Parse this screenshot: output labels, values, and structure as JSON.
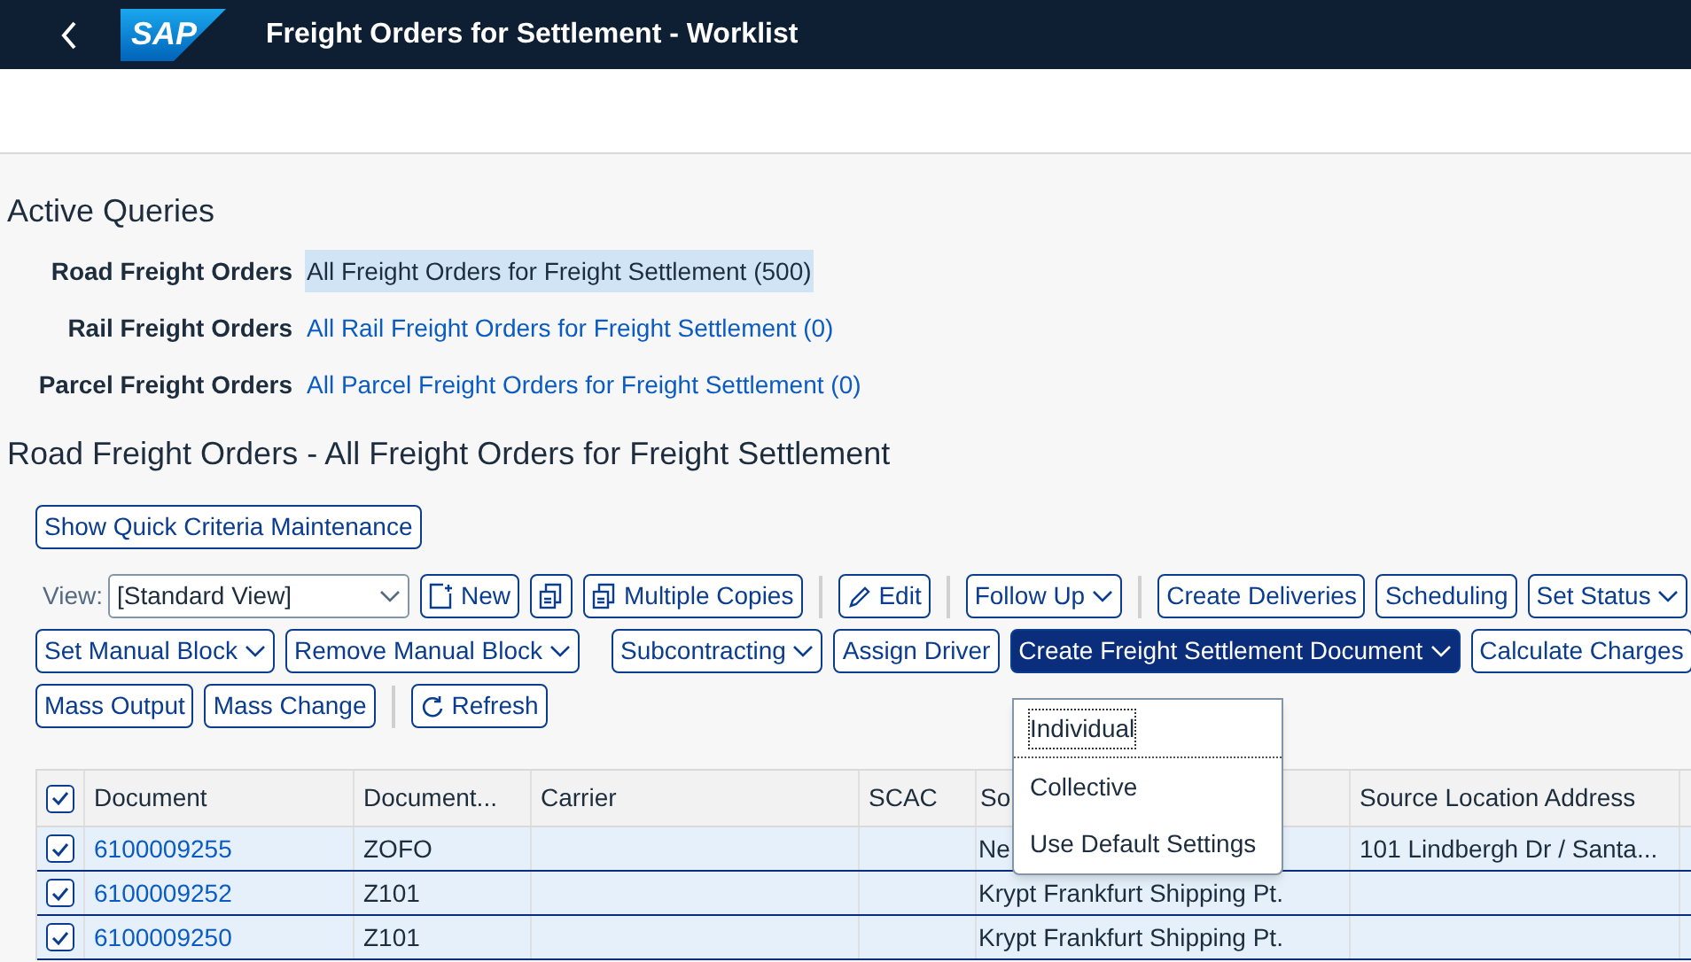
{
  "shell": {
    "logo": "SAP",
    "title": "Freight Orders for Settlement - Worklist"
  },
  "active_queries": {
    "title": "Active Queries",
    "queries": [
      {
        "label": "Road Freight Orders",
        "link": "All Freight Orders for Freight Settlement (500)",
        "selected": true
      },
      {
        "label": "Rail Freight Orders",
        "link": "All Rail Freight Orders for Freight Settlement (0)",
        "selected": false
      },
      {
        "label": "Parcel Freight Orders",
        "link": "All Parcel Freight Orders for Freight Settlement (0)",
        "selected": false
      }
    ]
  },
  "section_title": "Road Freight Orders - All Freight Orders for Freight Settlement",
  "quick_criteria_button": "Show Quick Criteria Maintenance",
  "toolbar_rows": [
    [
      {
        "kind": "view",
        "label": "View:",
        "value": "[Standard View]"
      },
      {
        "kind": "new",
        "label": "New"
      },
      {
        "kind": "copy"
      },
      {
        "kind": "copy",
        "label": "Multiple Copies"
      },
      {
        "kind": "separator"
      },
      {
        "kind": "edit",
        "label": "Edit"
      },
      {
        "kind": "separator"
      },
      {
        "kind": "menu",
        "label": "Follow Up",
        "expanded": false
      },
      {
        "kind": "separator"
      },
      {
        "kind": "button",
        "label": "Create Deliveries"
      },
      {
        "kind": "button",
        "label": "Scheduling"
      },
      {
        "kind": "menu",
        "label": "Set Status",
        "expanded": false
      }
    ],
    [
      {
        "kind": "menu",
        "label": "Set Manual Block",
        "expanded": false
      },
      {
        "kind": "menu",
        "label": "Remove Manual Block",
        "expanded": false
      },
      {
        "kind": "separator"
      },
      {
        "kind": "menu",
        "label": "Subcontracting",
        "expanded": false
      },
      {
        "kind": "button",
        "label": "Assign Driver"
      },
      {
        "kind": "menu",
        "label": "Create Freight Settlement Document",
        "expanded": true
      },
      {
        "kind": "button",
        "label": "Calculate Charges"
      }
    ],
    [
      {
        "kind": "button",
        "label": "Mass Output"
      },
      {
        "kind": "button",
        "label": "Mass Change"
      },
      {
        "kind": "separator"
      },
      {
        "kind": "refresh",
        "label": "Refresh"
      }
    ]
  ],
  "menu": {
    "items": [
      {
        "label": "Individual",
        "focused": true
      },
      {
        "label": "Collective",
        "focused": false
      },
      {
        "label": "Use Default Settings",
        "focused": false
      }
    ]
  },
  "table": {
    "all_checked": true,
    "columns": [
      "Document",
      "Document...",
      "Carrier",
      "SCAC",
      "So",
      "Source Location Address"
    ],
    "rows": [
      {
        "selected": true,
        "cells": [
          "6100009255",
          "ZOFO",
          "",
          "",
          "Ne",
          "101 Lindbergh Dr / Santa..."
        ]
      },
      {
        "selected": true,
        "cells": [
          "6100009252",
          "Z101",
          "",
          "",
          "Krypt Frankfurt Shipping Pt.",
          ""
        ]
      },
      {
        "selected": true,
        "cells": [
          "6100009250",
          "Z101",
          "",
          "",
          "Krypt Frankfurt Shipping Pt.",
          ""
        ]
      }
    ]
  }
}
